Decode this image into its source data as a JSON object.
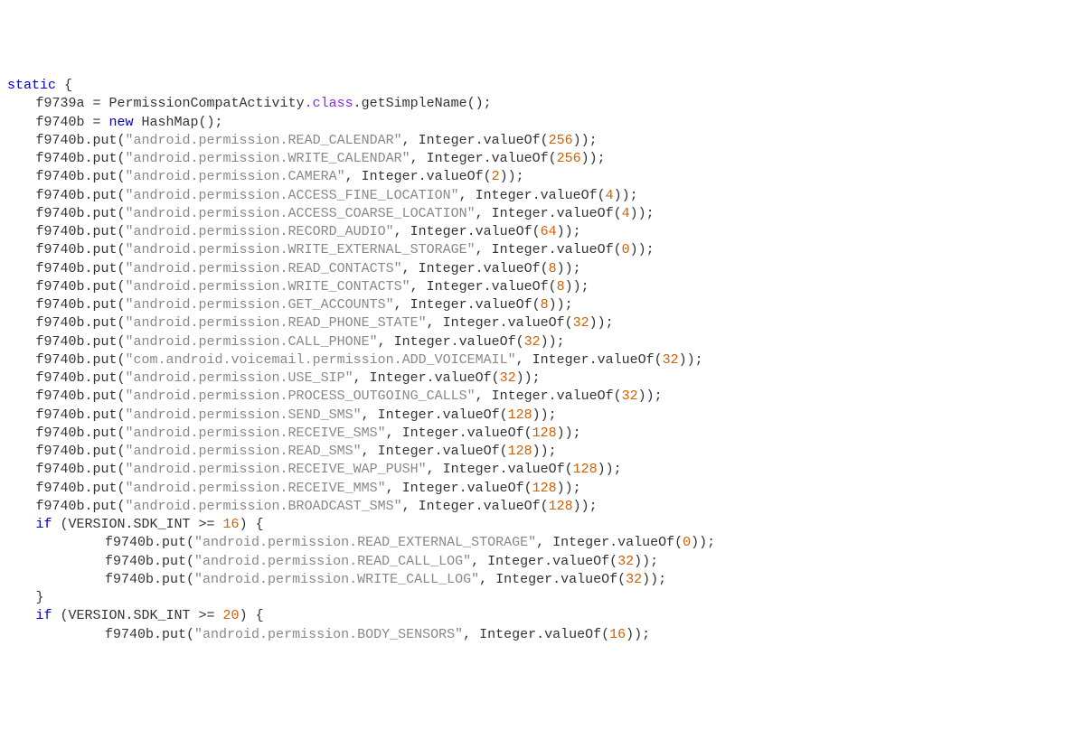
{
  "code": {
    "l0": "static {",
    "assign1_var": "f9739a",
    "assign1_eq": " = ",
    "assign1_type": "PermissionCompatActivity",
    "assign1_class": ".class",
    "assign1_call": ".getSimpleName();",
    "assign2_var": "f9740b",
    "assign2_eq": " = ",
    "assign2_new": "new",
    "assign2_rest": " HashMap();",
    "put_prefix": "f9740b.put(",
    "put_mid": ", Integer.valueOf(",
    "put_end": "));",
    "entries": [
      {
        "perm": "\"android.permission.READ_CALENDAR\"",
        "val": "256"
      },
      {
        "perm": "\"android.permission.WRITE_CALENDAR\"",
        "val": "256"
      },
      {
        "perm": "\"android.permission.CAMERA\"",
        "val": "2"
      },
      {
        "perm": "\"android.permission.ACCESS_FINE_LOCATION\"",
        "val": "4"
      },
      {
        "perm": "\"android.permission.ACCESS_COARSE_LOCATION\"",
        "val": "4"
      },
      {
        "perm": "\"android.permission.RECORD_AUDIO\"",
        "val": "64"
      },
      {
        "perm": "\"android.permission.WRITE_EXTERNAL_STORAGE\"",
        "val": "0"
      },
      {
        "perm": "\"android.permission.READ_CONTACTS\"",
        "val": "8"
      },
      {
        "perm": "\"android.permission.WRITE_CONTACTS\"",
        "val": "8"
      },
      {
        "perm": "\"android.permission.GET_ACCOUNTS\"",
        "val": "8"
      },
      {
        "perm": "\"android.permission.READ_PHONE_STATE\"",
        "val": "32"
      },
      {
        "perm": "\"android.permission.CALL_PHONE\"",
        "val": "32"
      },
      {
        "perm": "\"com.android.voicemail.permission.ADD_VOICEMAIL\"",
        "val": "32"
      },
      {
        "perm": "\"android.permission.USE_SIP\"",
        "val": "32"
      },
      {
        "perm": "\"android.permission.PROCESS_OUTGOING_CALLS\"",
        "val": "32"
      },
      {
        "perm": "\"android.permission.SEND_SMS\"",
        "val": "128"
      },
      {
        "perm": "\"android.permission.RECEIVE_SMS\"",
        "val": "128"
      },
      {
        "perm": "\"android.permission.READ_SMS\"",
        "val": "128"
      },
      {
        "perm": "\"android.permission.RECEIVE_WAP_PUSH\"",
        "val": "128"
      },
      {
        "perm": "\"android.permission.RECEIVE_MMS\"",
        "val": "128"
      },
      {
        "perm": "\"android.permission.BROADCAST_SMS\"",
        "val": "128"
      }
    ],
    "if1_kw": "if",
    "if1_cond": " (VERSION.SDK_INT >= ",
    "if1_num": "16",
    "if1_close": ") {",
    "if1_entries": [
      {
        "perm": "\"android.permission.READ_EXTERNAL_STORAGE\"",
        "val": "0"
      },
      {
        "perm": "\"android.permission.READ_CALL_LOG\"",
        "val": "32"
      },
      {
        "perm": "\"android.permission.WRITE_CALL_LOG\"",
        "val": "32"
      }
    ],
    "brace_close": "}",
    "if2_kw": "if",
    "if2_cond": " (VERSION.SDK_INT >= ",
    "if2_num": "20",
    "if2_close": ") {",
    "if2_entries": [
      {
        "perm": "\"android.permission.BODY_SENSORS\"",
        "val": "16"
      }
    ]
  }
}
